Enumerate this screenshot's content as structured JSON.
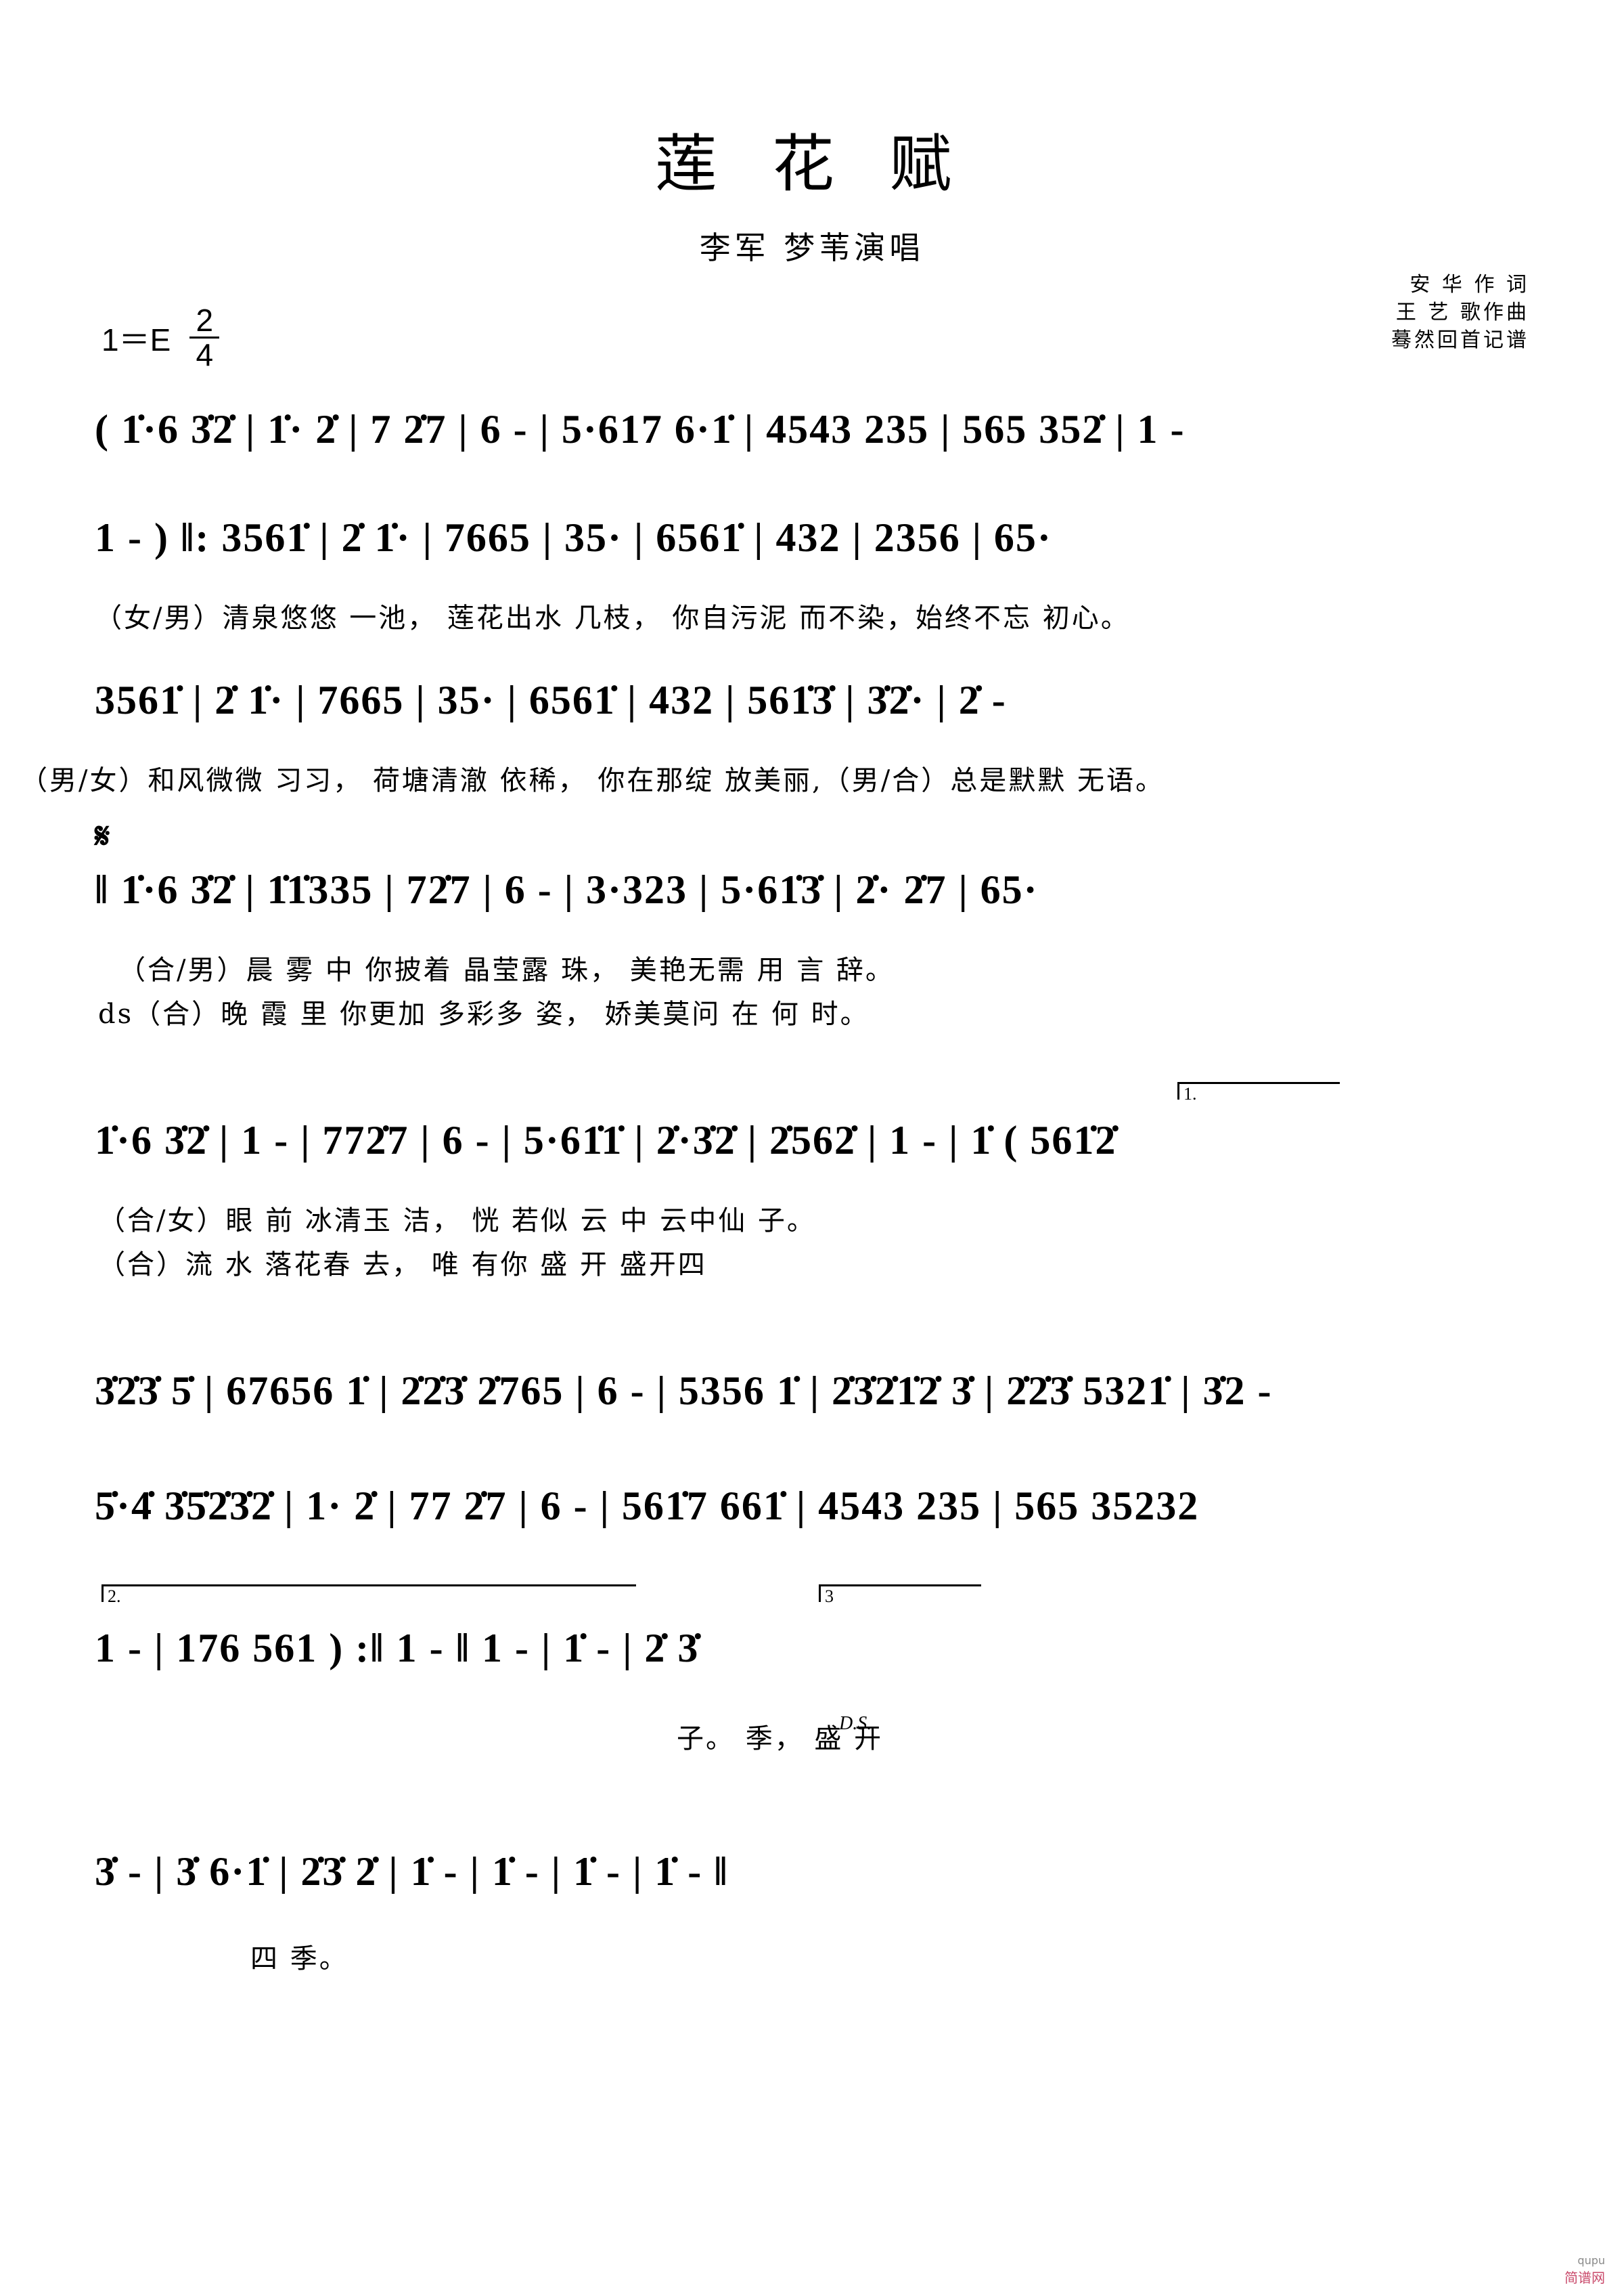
{
  "header": {
    "title": "莲 花 赋",
    "performers": "李军  梦苇演唱",
    "credits": [
      "安 华 作 词",
      "王 艺 歌作曲",
      "蓦然回首记谱"
    ],
    "key_label": "1＝E",
    "meter_top": "2",
    "meter_bottom": "4"
  },
  "score": {
    "lines": [
      {
        "id": "line-1",
        "notes": "( 1̇·6 3̇2̇ | 1̇· 2̇ | 7 2̇7 | 6 - | 5·617 6·1̇ | 4543 235 | 565 352̇ | 1 -",
        "lyrics": ""
      },
      {
        "id": "line-2",
        "notes": "1 - ) ‖: 3561̇ | 2̇ 1̇· | 7665 | 35· | 6561̇ | 432 | 2356 | 65·",
        "lyrics": "（女/男）清泉悠悠  一池，  莲花出水  几枝，  你自污泥  而不染，始终不忘  初心。"
      },
      {
        "id": "line-3",
        "notes": "3561̇ | 2̇ 1̇· | 7665 | 35· | 6561̇ | 432 | 561̇3̇ | 3̇2̇· | 2̇ -",
        "lyrics": "（男/女）和风微微  习习，  荷塘清澈  依稀，  你在那绽  放美丽,（男/合）总是默默  无语。"
      },
      {
        "id": "line-4",
        "notes": "‖ 1̇·6 3̇2̇ | 1̇1̇335 | 72̇7 | 6 - | 3·323 | 5·61̇3̇ | 2̇· 2̇7 | 65·",
        "lyrics_1": "（合/男）晨  雾   中   你披着  晶莹露  珠，  美艳无需  用  言  辞。",
        "lyrics_2": "ds（合）晚  霞   里   你更加  多彩多  姿，  娇美莫问  在  何   时。"
      },
      {
        "id": "line-5",
        "notes": "1̇·6 3̇2̇ | 1 - | 772̇7 | 6 - | 5·61̇1̇ | 2̇·3̇2̇ | 2̇562̇ | 1 - | 1̇ ( 561̇2̇",
        "lyrics_1": "（合/女）眼    前   冰清玉  洁，  恍  若似  云  中  云中仙    子。",
        "lyrics_2": "（合）流    水   落花春  去，  唯  有你  盛  开  盛开四"
      },
      {
        "id": "line-6",
        "notes": "3̇2̇3̇ 5̇ | 67656 1̇ | 2̇2̇3̇ 2̇765 | 6 - | 5356 1̇ | 2̇3̇2̇1̇2̇ 3̇ | 2̇2̇3̇ 5321̇ | 3̇2 -",
        "lyrics": ""
      },
      {
        "id": "line-7",
        "notes": "5̇·4̇ 3̇5̇2̇3̇2̇ | 1· 2̇ | 77 2̇7 | 6 - | 561̇7 661̇ | 4543 235 | 565 35232",
        "lyrics": ""
      },
      {
        "id": "line-8",
        "notes": "1 - | 176 561 ) :‖ 1 - ‖ 1 - | 1̇ - | 2̇ 3̇",
        "lyrics": "子。      季，            盛 开",
        "ds_label": "D.S."
      },
      {
        "id": "line-9",
        "notes": "3̇ - | 3̇ 6·1̇ | 2̇3̇ 2̇ | 1̇ - | 1̇ - | 1̇ - | 1̇ - ‖",
        "lyrics": "四      季。"
      }
    ],
    "endings": [
      {
        "label": "1."
      },
      {
        "label": "2."
      },
      {
        "label": "3"
      }
    ],
    "symbols": {
      "segno": "𝄋",
      "ds": "D.S.",
      "repeat_start": "‖:",
      "repeat_end": ":‖"
    }
  },
  "watermark": {
    "site": "简谱网",
    "note": "qupu"
  }
}
